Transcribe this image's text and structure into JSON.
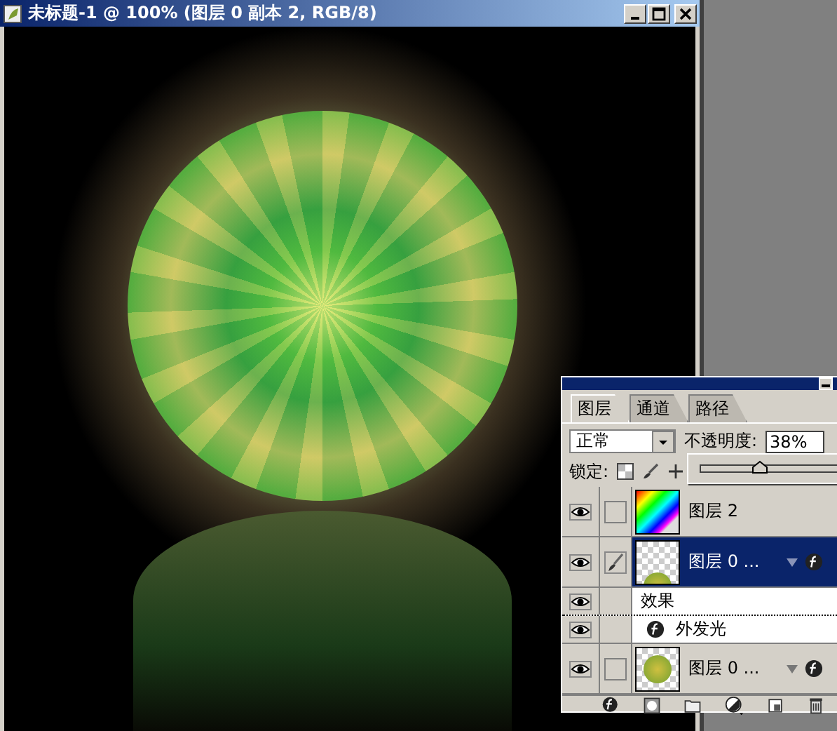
{
  "document": {
    "title": "未标题-1 @ 100% (图层 0 副本 2, RGB/8)"
  },
  "layers_panel": {
    "tabs": [
      {
        "label": "图层",
        "selected": true
      },
      {
        "label": "通道",
        "selected": false
      },
      {
        "label": "路径",
        "selected": false
      }
    ],
    "blend_mode": "正常",
    "opacity_label": "不透明度:",
    "opacity_value": "38%",
    "opacity_slider": {
      "level": 0.38
    },
    "lock_label": "锁定:",
    "layers": [
      {
        "kind": "layer",
        "name": "图层 2",
        "visible": true,
        "selected": false,
        "thumbnail": {
          "kind": "rainbow"
        },
        "has_effects": false
      },
      {
        "kind": "layer",
        "name": "图层 0 ...",
        "visible": true,
        "selected": true,
        "thumbnail": {
          "kind": "orb-partial"
        },
        "has_effects": true
      },
      {
        "kind": "effects",
        "name": "效果",
        "visible": true
      },
      {
        "kind": "effect",
        "name": "外发光",
        "visible": true
      },
      {
        "kind": "layer",
        "name": "图层 0 ...",
        "visible": true,
        "selected": false,
        "thumbnail": {
          "kind": "orb"
        },
        "has_effects": true
      }
    ]
  }
}
